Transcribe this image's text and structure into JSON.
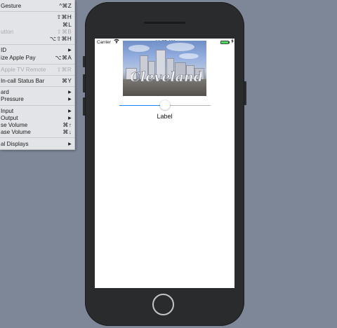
{
  "menu": {
    "items": [
      {
        "label": "Gesture",
        "shortcut": "^⌘Z",
        "disabled": false
      },
      {
        "label": "",
        "shortcut": "⇧⌘H",
        "disabled": false
      },
      {
        "label": "",
        "shortcut": "⌘L",
        "disabled": false
      },
      {
        "label": "utton",
        "shortcut": "⇧⌘B",
        "disabled": true
      },
      {
        "label": "",
        "shortcut": "⌥⇧⌘H",
        "disabled": false
      },
      {
        "label": "ID",
        "shortcut": "▶",
        "disabled": false
      },
      {
        "label": "ize Apple Pay",
        "shortcut": "⌥⌘A",
        "disabled": false
      },
      {
        "label": "Apple TV Remote",
        "shortcut": "⇧⌘R",
        "disabled": true
      },
      {
        "label": "In-call Status Bar",
        "shortcut": "⌘Y",
        "disabled": false
      },
      {
        "label": "ard",
        "shortcut": "▶",
        "disabled": false
      },
      {
        "label": "Pressure",
        "shortcut": "▶",
        "disabled": false
      },
      {
        "label": "Input",
        "shortcut": "▶",
        "disabled": false
      },
      {
        "label": "Output",
        "shortcut": "▶",
        "disabled": false
      },
      {
        "label": "se Volume",
        "shortcut": "⌘↑",
        "disabled": false
      },
      {
        "label": "ase Volume",
        "shortcut": "⌘↓",
        "disabled": false
      },
      {
        "label": "al Displays",
        "shortcut": "▶",
        "disabled": false
      }
    ]
  },
  "status_bar": {
    "carrier": "Carrier",
    "time": "10:57 AM",
    "battery_level": 1.0
  },
  "photo": {
    "sign_text": "Cleveland"
  },
  "slider": {
    "value": 0.5
  },
  "label": {
    "text": "Label"
  },
  "colors": {
    "accent": "#1a82fb",
    "battery": "#4cd964",
    "background": "#7e8797"
  }
}
